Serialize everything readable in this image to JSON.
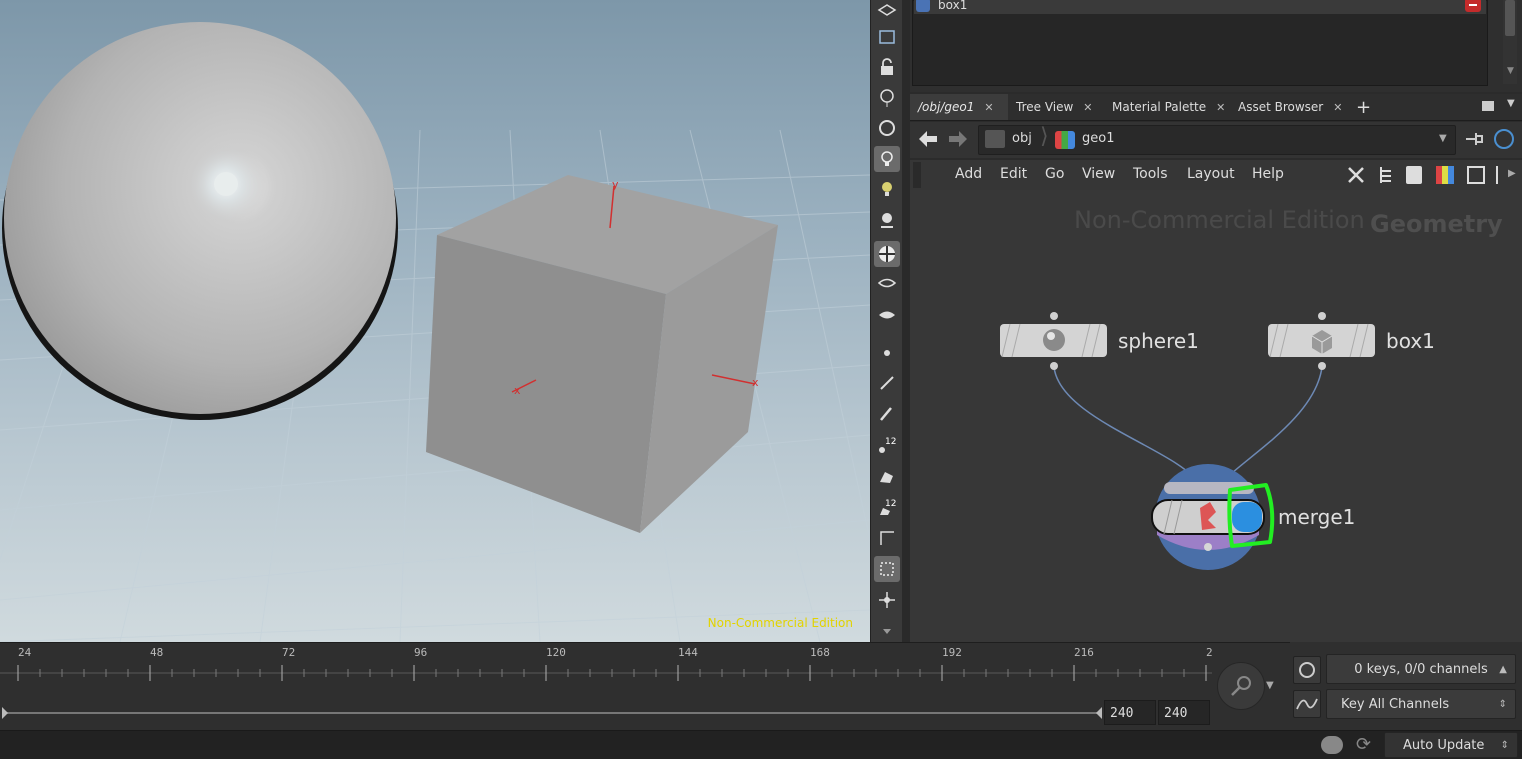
{
  "viewport": {
    "watermark": "Non-Commercial Edition",
    "axis_y": "y",
    "axis_x": "x",
    "axis_x2": "x"
  },
  "params": {
    "row_label": "box1"
  },
  "tabs": [
    {
      "label": "/obj/geo1"
    },
    {
      "label": "Tree View"
    },
    {
      "label": "Material Palette"
    },
    {
      "label": "Asset Browser"
    }
  ],
  "path": {
    "crumb1": "obj",
    "crumb2": "geo1"
  },
  "menu": [
    "Add",
    "Edit",
    "Go",
    "View",
    "Tools",
    "Layout",
    "Help"
  ],
  "network": {
    "watermark": "Non-Commercial Edition",
    "context": "Geometry",
    "nodes": [
      {
        "label": "sphere1"
      },
      {
        "label": "box1"
      },
      {
        "label": "merge1"
      }
    ]
  },
  "timeline": {
    "ticks": [
      "24",
      "48",
      "72",
      "96",
      "120",
      "144",
      "168",
      "192",
      "216",
      "2"
    ],
    "end_frame": "240",
    "global_end": "240"
  },
  "keys": {
    "channels": "0 keys, 0/0 channels",
    "key_mode": "Key All Channels"
  },
  "status": {
    "update_mode": "Auto Update"
  },
  "colors": {
    "selection_highlight": "#22ee22",
    "viewport_watermark": "#e2d300",
    "merge_node_ring": "#4a6fa8"
  }
}
